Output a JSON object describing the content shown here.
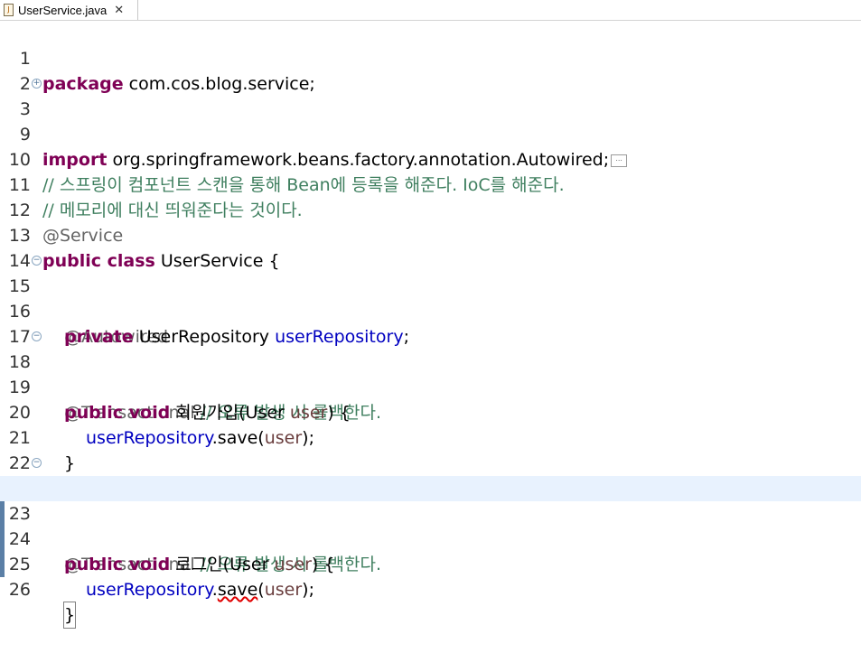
{
  "tab": {
    "title": "UserService.java",
    "close": "✕",
    "file_icon": "java-file-icon"
  },
  "lines": {
    "l1": {
      "num": "1",
      "k": "package",
      "rest": " com.cos.blog.service;"
    },
    "l2": {
      "num": "2"
    },
    "l3": {
      "num": "3",
      "k": "import",
      "rest": " org.springframework.beans.factory.annotation.Autowired;",
      "collapsed": "..."
    },
    "l9": {
      "num": "9"
    },
    "l10": {
      "num": "10",
      "comment": "// 스프링이 컴포넌트 스캔을 통해 Bean에 등록을 해준다. IoC를 해준다."
    },
    "l11": {
      "num": "11",
      "comment": "// 메모리에 대신 띄워준다는 것이다."
    },
    "l12": {
      "num": "12",
      "annotation": "@Service"
    },
    "l13": {
      "num": "13",
      "k": "public class",
      "rest": " UserService {"
    },
    "l14": {
      "num": "14"
    },
    "l15": {
      "num": "15",
      "annotation": "@Autowired"
    },
    "l16": {
      "num": "16",
      "k": "private",
      "type": " UserRepository ",
      "field": "userRepository",
      "end": ";"
    },
    "l17": {
      "num": "17"
    },
    "l18": {
      "num": "18",
      "annotation": "@Transactional",
      "comment": " // 오류 발생 시 롤백한다."
    },
    "l19": {
      "num": "19",
      "k": "public void",
      "name": " 회원가입(User ",
      "param": "user",
      "end": ") {"
    },
    "l20": {
      "num": "20",
      "field": "userRepository",
      "mid": ".save(",
      "param": "user",
      "end": ");"
    },
    "l21": {
      "num": "21",
      "text": "}"
    },
    "l22": {
      "num": "22"
    },
    "l23": {
      "num": "23",
      "annotation": "@Transactional",
      "comment": " // 오류 발생 시 롤백한다."
    },
    "l24": {
      "num": "24",
      "k": "public void",
      "name": " 로그인(User ",
      "param": "user",
      "end": ") {"
    },
    "l25": {
      "num": "25",
      "field": "userRepository",
      "dot": ".",
      "err": "save",
      "open": "(",
      "param": "user",
      "end": ");"
    },
    "l26": {
      "num": "26",
      "text": "}"
    }
  },
  "colors": {
    "keyword": "#7f0055",
    "comment": "#3f7f5f",
    "annotation": "#646464",
    "field": "#0000c0",
    "param": "#6a3e3e",
    "current_line": "#e8f2fe"
  }
}
